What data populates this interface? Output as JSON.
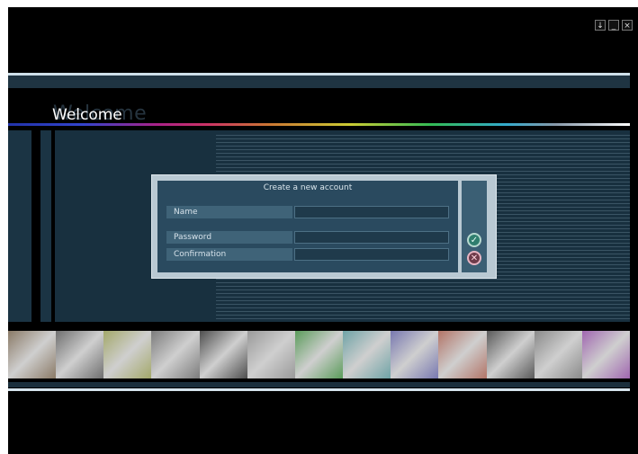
{
  "window_controls": [
    {
      "name": "download-icon",
      "glyph": "↓"
    },
    {
      "name": "minimize-icon",
      "glyph": "_"
    },
    {
      "name": "close-icon",
      "glyph": "×"
    }
  ],
  "header": {
    "welcome_ghost": "Welcome",
    "welcome": "Welcome"
  },
  "dialog": {
    "title": "Create a new account",
    "fields": [
      {
        "label": "Name",
        "value": ""
      },
      {
        "label": "Password",
        "value": ""
      },
      {
        "label": "Confirmation",
        "value": ""
      }
    ],
    "ok_glyph": "✓",
    "cancel_glyph": "✕"
  },
  "colors": {
    "background": "#000000",
    "panel": "#18303f",
    "dialog_frame": "#b9c9d3",
    "dialog_body": "#2a4a5f",
    "ok": "#2f7e6e",
    "cancel": "#6e3b4a"
  },
  "photostrip": [
    {
      "name": "photo-1",
      "color": "#8a7a66"
    },
    {
      "name": "photo-2",
      "color": "#6f6f6f"
    },
    {
      "name": "photo-3",
      "color": "#a3a86a"
    },
    {
      "name": "photo-4",
      "color": "#7c7c7c"
    },
    {
      "name": "photo-5",
      "color": "#4e4e4e"
    },
    {
      "name": "photo-6",
      "color": "#9a9a9a"
    },
    {
      "name": "photo-7",
      "color": "#5b9c5b"
    },
    {
      "name": "photo-8",
      "color": "#6fa3a6"
    },
    {
      "name": "photo-9",
      "color": "#7878b0"
    },
    {
      "name": "photo-10",
      "color": "#b27467"
    },
    {
      "name": "photo-11",
      "color": "#5a5a5a"
    },
    {
      "name": "photo-12",
      "color": "#8a8a8a"
    },
    {
      "name": "photo-13",
      "color": "#a066b0"
    }
  ]
}
